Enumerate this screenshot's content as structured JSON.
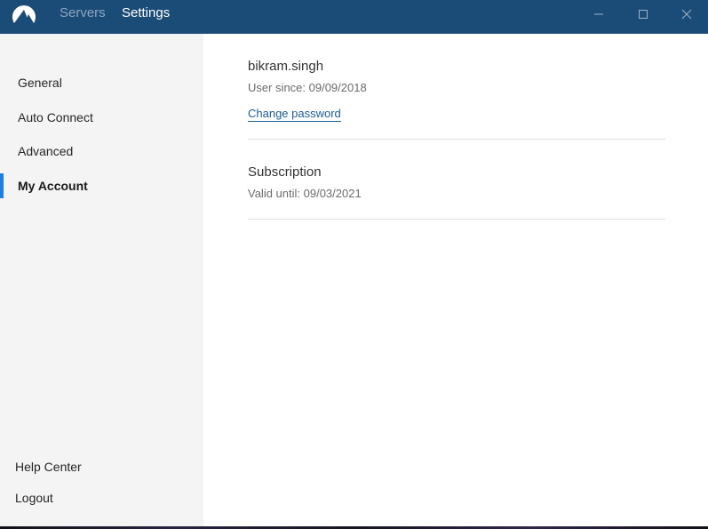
{
  "titlebar": {
    "tabs": {
      "servers": "Servers",
      "settings": "Settings"
    },
    "colors": {
      "background": "#1b4c78",
      "active_tab": "#ffffff",
      "inactive_tab": "#8fa6bf"
    },
    "icons": [
      "nordvpn-logo-icon",
      "minimize-icon",
      "maximize-icon",
      "close-icon"
    ]
  },
  "sidebar": {
    "items": [
      {
        "label": "General",
        "active": false
      },
      {
        "label": "Auto Connect",
        "active": false
      },
      {
        "label": "Advanced",
        "active": false
      },
      {
        "label": "My Account",
        "active": true
      }
    ],
    "bottom": {
      "help": "Help Center",
      "logout": "Logout"
    },
    "accent_color": "#1f7fe0"
  },
  "account": {
    "username": "bikram.singh",
    "user_since": "User since: 09/09/2018",
    "change_password": "Change password",
    "subscription_title": "Subscription",
    "valid_until": "Valid until: 09/03/2021"
  }
}
